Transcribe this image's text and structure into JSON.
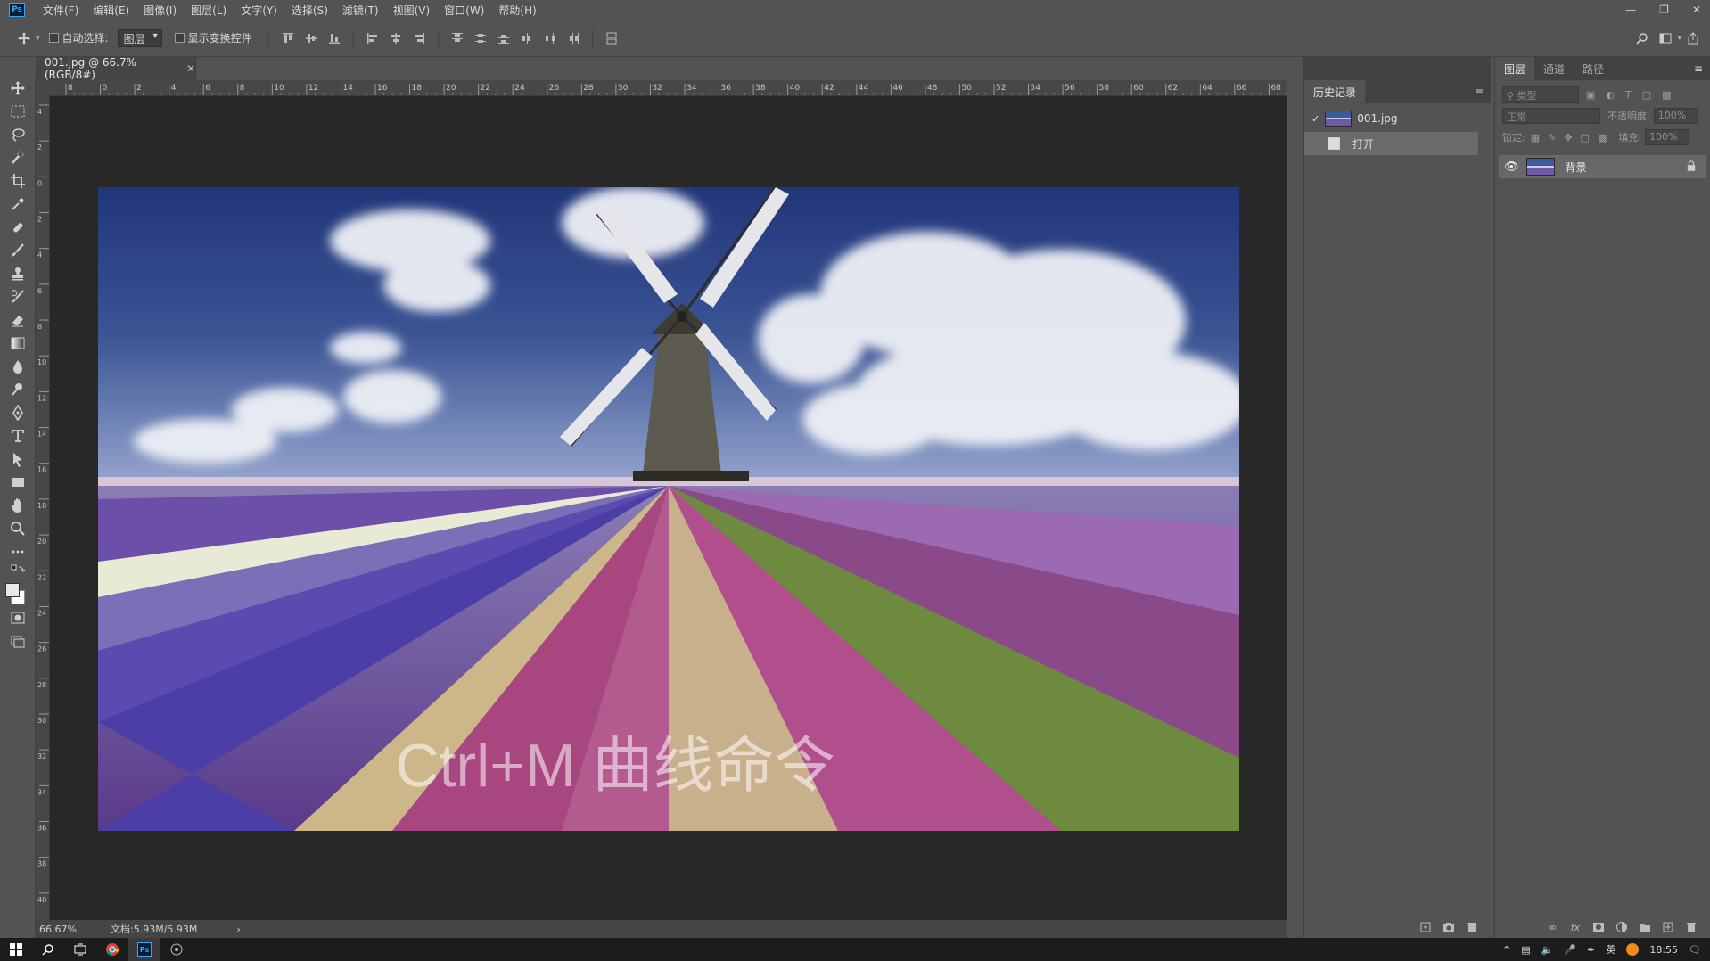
{
  "app": {
    "name": "Ps"
  },
  "menubar": {
    "items": [
      "文件(F)",
      "编辑(E)",
      "图像(I)",
      "图层(L)",
      "文字(Y)",
      "选择(S)",
      "滤镜(T)",
      "视图(V)",
      "窗口(W)",
      "帮助(H)"
    ]
  },
  "options_bar": {
    "auto_select_label": "自动选择:",
    "auto_select_value": "图层",
    "show_transform_label": "显示变换控件"
  },
  "document": {
    "tab_title": "001.jpg @ 66.7%(RGB/8#)",
    "overlay_text": "Ctrl+M 曲线命令",
    "zoom": "66.67%",
    "doc_size": "文档:5.93M/5.93M"
  },
  "ruler": {
    "h_ticks": [
      "8",
      "0",
      "2",
      "4",
      "6",
      "8",
      "10",
      "12",
      "14",
      "16",
      "18",
      "20",
      "22",
      "24",
      "26",
      "28",
      "30",
      "32",
      "34",
      "36",
      "38",
      "40",
      "42",
      "44",
      "46",
      "48",
      "50",
      "52",
      "54",
      "56",
      "58",
      "60",
      "62",
      "64",
      "66",
      "68"
    ],
    "v_ticks": [
      "4",
      "2",
      "0",
      "2",
      "4",
      "6",
      "8",
      "1 0",
      "1 2",
      "1 4",
      "1 6",
      "1 8",
      "2 0",
      "2 2",
      "2 4",
      "2 6",
      "2 8",
      "3 0",
      "3 2",
      "3 4",
      "3 6",
      "3 8",
      "4 0"
    ]
  },
  "history_panel": {
    "tab_label": "历史记录",
    "snapshot_label": "001.jpg",
    "states": [
      "打开"
    ]
  },
  "layers_panel": {
    "tabs": [
      "图层",
      "通道",
      "路径"
    ],
    "search_placeholder": "类型",
    "blend_mode": "正常",
    "opacity_label": "不透明度:",
    "opacity_value": "100%",
    "lock_label": "锁定:",
    "fill_label": "填充:",
    "fill_value": "100%",
    "layers": [
      {
        "name": "背景"
      }
    ]
  },
  "taskbar": {
    "ime": "英",
    "time": "18:55"
  }
}
